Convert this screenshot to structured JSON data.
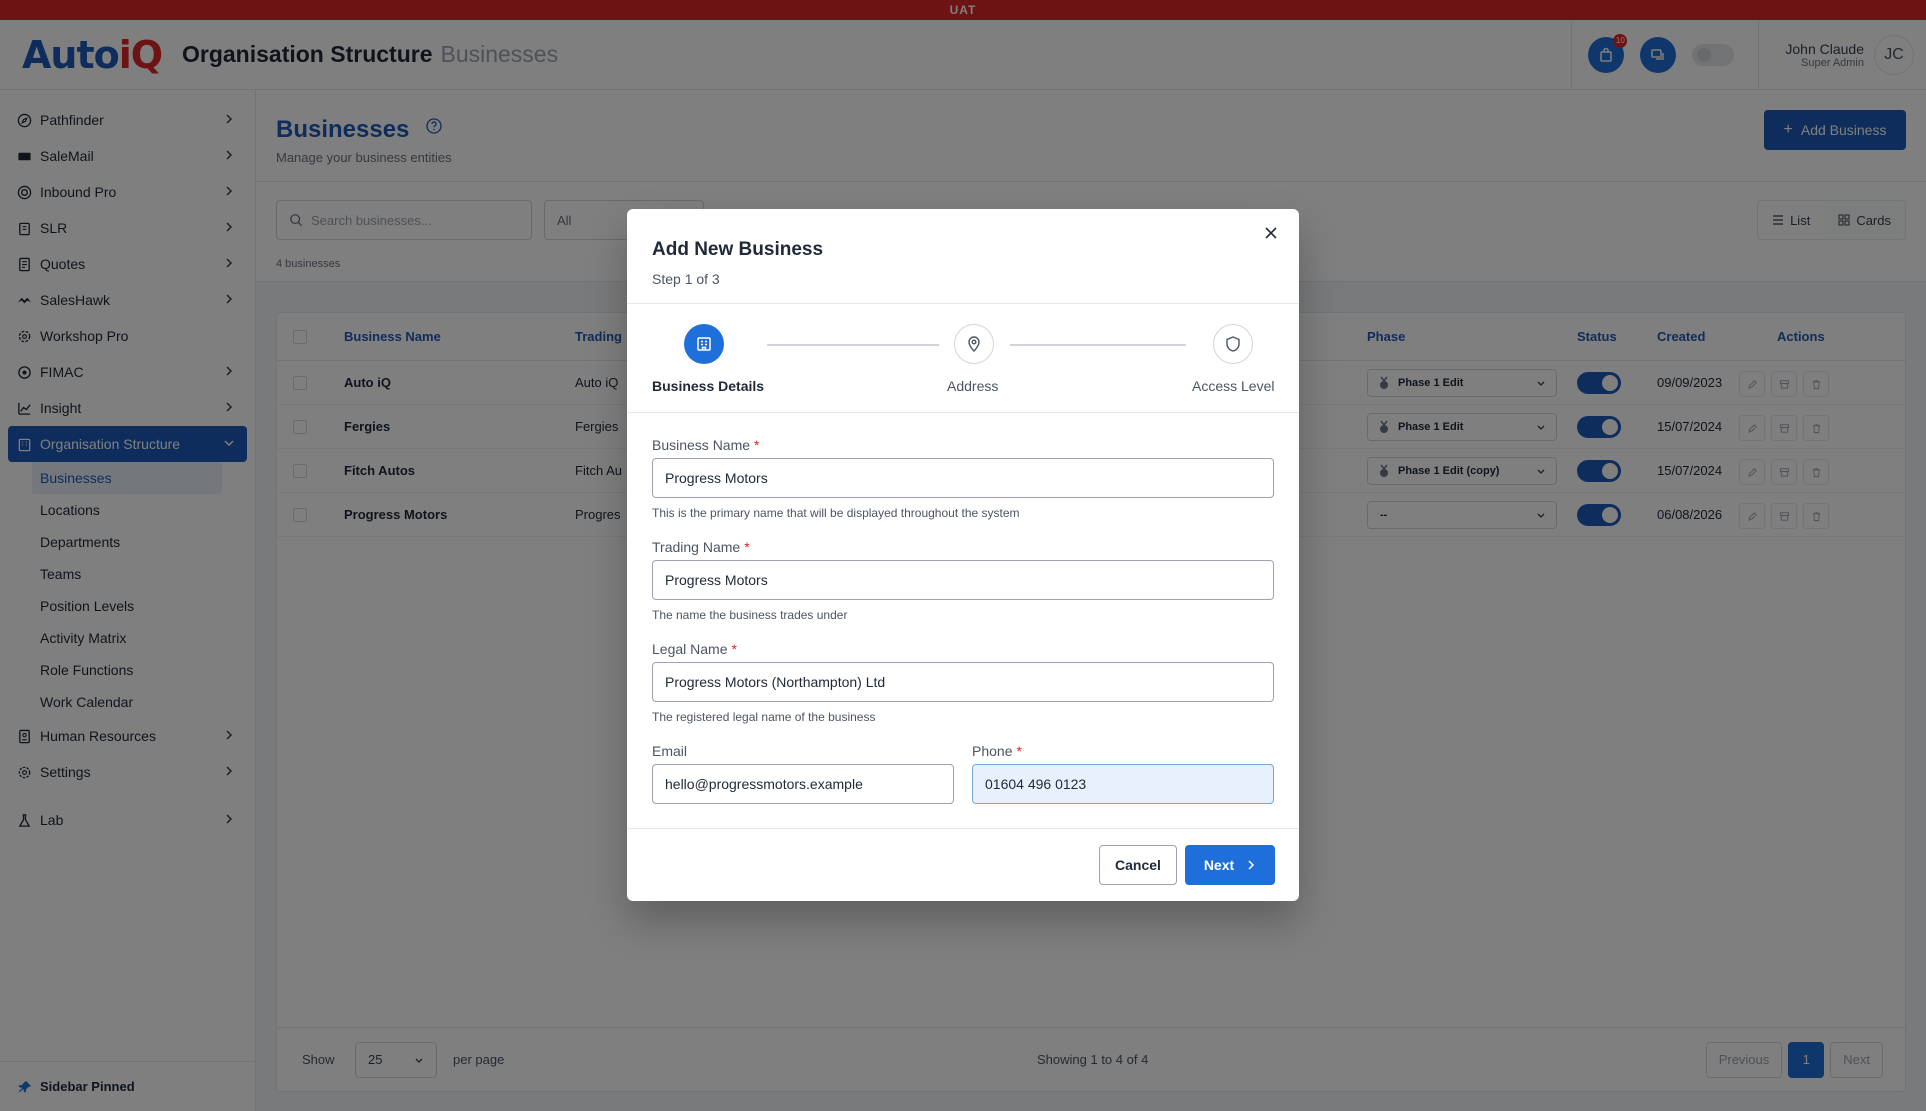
{
  "env_banner": "UAT",
  "header": {
    "title": "Organisation Structure",
    "subtitle": "Businesses",
    "notification_count": "10",
    "user_name": "John Claude",
    "user_role": "Super Admin",
    "user_initials": "JC"
  },
  "sidebar": {
    "items": [
      {
        "label": "Pathfinder"
      },
      {
        "label": "SaleMail"
      },
      {
        "label": "Inbound Pro"
      },
      {
        "label": "SLR"
      },
      {
        "label": "Quotes"
      },
      {
        "label": "SalesHawk"
      },
      {
        "label": "Workshop Pro"
      },
      {
        "label": "FIMAC"
      },
      {
        "label": "Insight"
      },
      {
        "label": "Organisation Structure"
      }
    ],
    "sub_items": [
      {
        "label": "Businesses"
      },
      {
        "label": "Locations"
      },
      {
        "label": "Departments"
      },
      {
        "label": "Teams"
      },
      {
        "label": "Position Levels"
      },
      {
        "label": "Activity Matrix"
      },
      {
        "label": "Role Functions"
      },
      {
        "label": "Work Calendar"
      }
    ],
    "bottom_items": [
      {
        "label": "Human Resources"
      },
      {
        "label": "Settings"
      },
      {
        "label": "Lab"
      }
    ],
    "footer": "Sidebar Pinned"
  },
  "page": {
    "title": "Businesses",
    "subtitle": "Manage your business entities",
    "add_button": "Add Business",
    "search_placeholder": "Search businesses...",
    "filter_value": "All",
    "count": "4 businesses",
    "view_list": "List",
    "view_cards": "Cards"
  },
  "table": {
    "headers": {
      "name": "Business Name",
      "trading": "Trading",
      "phase": "Phase",
      "status": "Status",
      "created": "Created",
      "actions": "Actions"
    },
    "rows": [
      {
        "name": "Auto iQ",
        "trading": "Auto iQ",
        "phase": "Phase 1 Edit",
        "created": "09/09/2023"
      },
      {
        "name": "Fergies",
        "trading": "Fergies",
        "phase": "Phase 1 Edit",
        "created": "15/07/2024"
      },
      {
        "name": "Fitch Autos",
        "trading": "Fitch Au",
        "phase": "Phase 1 Edit (copy)",
        "created": "15/07/2024"
      },
      {
        "name": "Progress Motors",
        "trading": "Progres",
        "phase": "--",
        "created": "06/08/2026"
      }
    ],
    "footer": {
      "show": "Show",
      "per_page_value": "25",
      "per_page": "per page",
      "showing": "Showing 1 to 4 of 4",
      "previous": "Previous",
      "current_page": "1",
      "next": "Next"
    }
  },
  "modal": {
    "title": "Add New Business",
    "step": "Step 1 of 3",
    "steps": [
      {
        "label": "Business Details"
      },
      {
        "label": "Address"
      },
      {
        "label": "Access Level"
      }
    ],
    "fields": {
      "business_name": {
        "label": "Business Name",
        "required": "*",
        "value": "Progress Motors",
        "help": "This is the primary name that will be displayed throughout the system"
      },
      "trading_name": {
        "label": "Trading Name",
        "required": "*",
        "value": "Progress Motors",
        "help": "The name the business trades under"
      },
      "legal_name": {
        "label": "Legal Name",
        "required": "*",
        "value": "Progress Motors (Northampton) Ltd",
        "help": "The registered legal name of the business"
      },
      "email": {
        "label": "Email",
        "value": "hello@progressmotors.example"
      },
      "phone": {
        "label": "Phone",
        "required": "*",
        "value": "01604 496 0123"
      }
    },
    "cancel": "Cancel",
    "next": "Next"
  },
  "colors": {
    "brand": "#1e5bb8",
    "accent": "#1e6fd9",
    "uat": "#dc2626"
  }
}
